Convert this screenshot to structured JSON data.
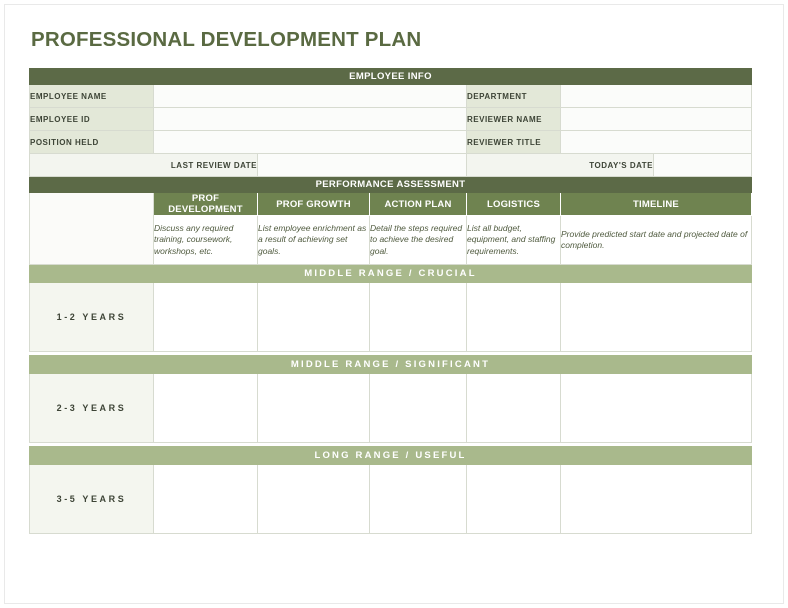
{
  "document": {
    "title": "PROFESSIONAL DEVELOPMENT PLAN"
  },
  "employee_info": {
    "section_title": "EMPLOYEE INFO",
    "left_fields": [
      {
        "label": "EMPLOYEE NAME",
        "value": ""
      },
      {
        "label": "EMPLOYEE ID",
        "value": ""
      },
      {
        "label": "POSITION HELD",
        "value": ""
      }
    ],
    "right_fields": [
      {
        "label": "DEPARTMENT",
        "value": ""
      },
      {
        "label": "REVIEWER NAME",
        "value": ""
      },
      {
        "label": "REVIEWER TITLE",
        "value": ""
      }
    ],
    "date_row": {
      "last_review_label": "LAST REVIEW DATE",
      "last_review_value": "",
      "todays_date_label": "TODAY'S DATE",
      "todays_date_value": ""
    }
  },
  "performance_assessment": {
    "section_title": "PERFORMANCE ASSESSMENT",
    "columns": [
      {
        "label": "PROF DEVELOPMENT",
        "description": "Discuss any required training, coursework, workshops, etc."
      },
      {
        "label": "PROF GROWTH",
        "description": "List employee enrichment as a result of achieving set goals."
      },
      {
        "label": "ACTION PLAN",
        "description": "Detail the steps required to achieve the desired goal."
      },
      {
        "label": "LOGISTICS",
        "description": "List all budget, equipment, and staffing requirements."
      },
      {
        "label": "TIMELINE",
        "description": "Provide predicted start date and projected date of completion."
      }
    ],
    "ranges": [
      {
        "band": "MIDDLE RANGE  /  CRUCIAL",
        "year_label": "1-2 YEARS",
        "entries": [
          "",
          "",
          "",
          "",
          ""
        ]
      },
      {
        "band": "MIDDLE RANGE  /  SIGNIFICANT",
        "year_label": "2-3 YEARS",
        "entries": [
          "",
          "",
          "",
          "",
          ""
        ]
      },
      {
        "band": "LONG RANGE  /  USEFUL",
        "year_label": "3-5 YEARS",
        "entries": [
          "",
          "",
          "",
          "",
          ""
        ]
      }
    ]
  },
  "colors": {
    "title_green": "#5a6a42",
    "header_dark_green": "#5c6a47",
    "column_header_green": "#6f8350",
    "band_light_green": "#a9b98c",
    "label_cell": "#e3e8d8",
    "description_text": "#4f5a3e"
  }
}
